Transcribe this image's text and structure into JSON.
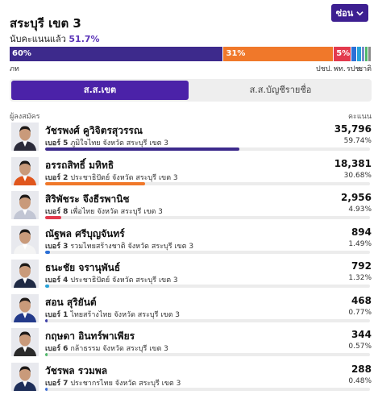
{
  "header": {
    "title": "สระบุรี เขต 3",
    "counted_label": "นับคะแนนแล้ว",
    "counted_pct": "51.7%",
    "hide_label": "ซ่อน"
  },
  "party_bar": [
    {
      "label": "60%",
      "abbr": "ภท",
      "pct": 59.74,
      "color": "#3d2a8c"
    },
    {
      "label": "31%",
      "abbr": "ปชป.",
      "pct": 30.68,
      "color": "#f0782a"
    },
    {
      "label": "5%",
      "abbr": "พท.",
      "pct": 4.93,
      "color": "#e33a4d"
    },
    {
      "label": "",
      "abbr": "",
      "pct": 1.49,
      "color": "#2b6fd6"
    },
    {
      "label": "",
      "abbr": "",
      "pct": 1.32,
      "color": "#27a3d9"
    },
    {
      "label": "",
      "abbr": "รปช.",
      "pct": 0.77,
      "color": "#7a8cc9"
    },
    {
      "label": "",
      "abbr": "",
      "pct": 0.57,
      "color": "#4fb86a"
    },
    {
      "label": "",
      "abbr": "ชาติ",
      "pct": 0.48,
      "color": "#8a8a8a"
    }
  ],
  "tabs": [
    {
      "label": "ส.ส.เขต",
      "active": true
    },
    {
      "label": "ส.ส.บัญชีรายชื่อ",
      "active": false
    }
  ],
  "columns": {
    "candidate": "ผู้ลงสมัคร",
    "votes": "คะแนน"
  },
  "candidates": [
    {
      "name": "วัชรพงศ์ คูวิจิตรสุวรรณ",
      "number_label": "เบอร์ 5",
      "detail": "ภูมิใจไทย จังหวัด สระบุรี เขต 3",
      "votes": "35,796",
      "pct_label": "59.74%",
      "pct": 59.74,
      "color": "#3d2a8c",
      "suit": "#2b2b3a"
    },
    {
      "name": "อรรถสิทธิ์ มหิทธิ",
      "number_label": "เบอร์ 2",
      "detail": "ประชาธิปัตย์ จังหวัด สระบุรี เขต 3",
      "votes": "18,381",
      "pct_label": "30.68%",
      "pct": 30.68,
      "color": "#f0782a",
      "suit": "#e0561d"
    },
    {
      "name": "สิริพัชระ จึงธีรพานิช",
      "number_label": "เบอร์ 8",
      "detail": "เพื่อไทย จังหวัด สระบุรี เขต 3",
      "votes": "2,956",
      "pct_label": "4.93%",
      "pct": 4.93,
      "color": "#e33a4d",
      "suit": "#c2c6d4"
    },
    {
      "name": "ณัฐพล ศรีบุญจันทร์",
      "number_label": "เบอร์ 3",
      "detail": "รวมไทยสร้างชาติ จังหวัด สระบุรี เขต 3",
      "votes": "894",
      "pct_label": "1.49%",
      "pct": 1.49,
      "color": "#2b6fd6",
      "suit": "#f4f4f4"
    },
    {
      "name": "ธนะชัย จรานุพันธ์",
      "number_label": "เบอร์ 4",
      "detail": "ประชาธิปัตย์ จังหวัด สระบุรี เขต 3",
      "votes": "792",
      "pct_label": "1.32%",
      "pct": 1.32,
      "color": "#27a3d9",
      "suit": "#1f2a44"
    },
    {
      "name": "สอน สุริยันต์",
      "number_label": "เบอร์ 1",
      "detail": "ไทยสร้างไทย จังหวัด สระบุรี เขต 3",
      "votes": "468",
      "pct_label": "0.77%",
      "pct": 0.77,
      "color": "#3d3fa8",
      "suit": "#233a8a"
    },
    {
      "name": "กฤษดา อินทร์พาเพียร",
      "number_label": "เบอร์ 6",
      "detail": "กล้าธรรม จังหวัด สระบุรี เขต 3",
      "votes": "344",
      "pct_label": "0.57%",
      "pct": 0.57,
      "color": "#4fb86a",
      "suit": "#2a2a2a"
    },
    {
      "name": "วัชรพล รวมพล",
      "number_label": "เบอร์ 7",
      "detail": "ประชากรไทย จังหวัด สระบุรี เขต 3",
      "votes": "288",
      "pct_label": "0.48%",
      "pct": 0.48,
      "color": "#3d6fd6",
      "suit": "#1f2f5a"
    }
  ]
}
